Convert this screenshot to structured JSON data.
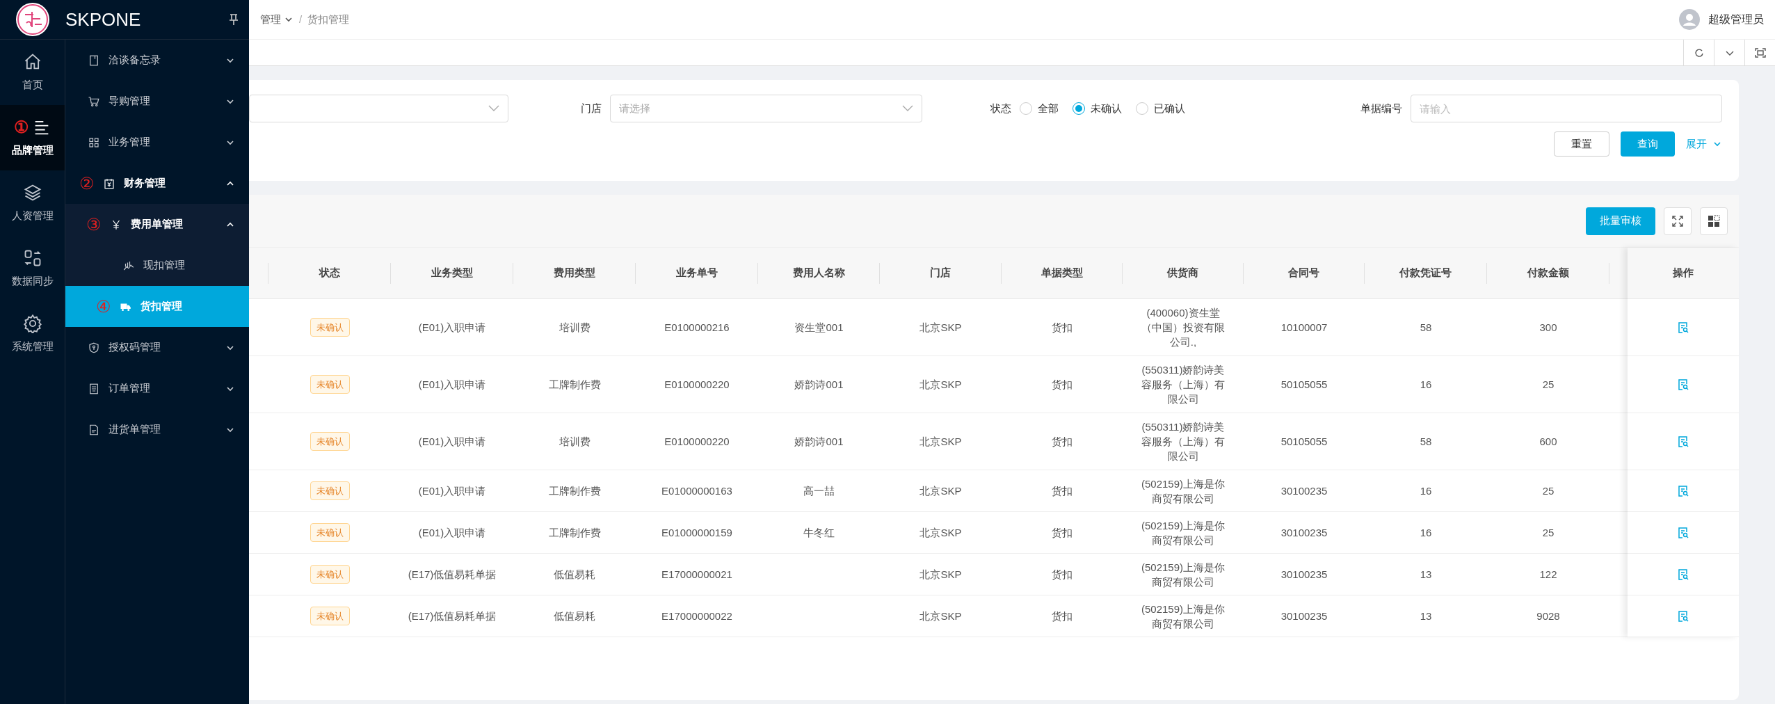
{
  "brand": {
    "name": "SKPONE"
  },
  "icon_nav": [
    {
      "label": "首页",
      "selected": false
    },
    {
      "label": "品牌管理",
      "selected": true,
      "marker": "①"
    },
    {
      "label": "人资管理",
      "selected": false
    },
    {
      "label": "数据同步",
      "selected": false
    },
    {
      "label": "系统管理",
      "selected": false
    }
  ],
  "menu": [
    {
      "label": "洽谈备忘录",
      "expanded": false,
      "selected": false
    },
    {
      "label": "导购管理",
      "expanded": false,
      "selected": false
    },
    {
      "label": "业务管理",
      "expanded": false,
      "selected": false
    },
    {
      "label": "财务管理",
      "expanded": true,
      "selected": false,
      "marker": "②",
      "children": [
        {
          "label": "费用单管理",
          "expanded": true,
          "selected": false,
          "marker": "③",
          "children": [
            {
              "label": "现扣管理",
              "selected": false
            },
            {
              "label": "货扣管理",
              "selected": true,
              "marker": "④"
            }
          ]
        }
      ]
    },
    {
      "label": "授权码管理",
      "expanded": false,
      "selected": false
    },
    {
      "label": "订单管理",
      "expanded": false,
      "selected": false
    },
    {
      "label": "进货单管理",
      "expanded": false,
      "selected": false
    }
  ],
  "breadcrumb": {
    "items": [
      "管理",
      "货扣管理"
    ],
    "separator": "/"
  },
  "user": {
    "name": "超级管理员"
  },
  "filters": {
    "store_label": "门店",
    "store_placeholder": "请选择",
    "status_label": "状态",
    "status_options": [
      {
        "label": "全部",
        "selected": false
      },
      {
        "label": "未确认",
        "selected": true
      },
      {
        "label": "已确认",
        "selected": false
      }
    ],
    "doc_no_label": "单据编号",
    "doc_no_placeholder": "请输入",
    "reset": "重置",
    "query": "查询",
    "expand": "展开"
  },
  "toolbar": {
    "batch": "批量审核"
  },
  "table": {
    "columns": [
      "状态",
      "业务类型",
      "费用类型",
      "业务单号",
      "费用人名称",
      "门店",
      "单据类型",
      "供货商",
      "合同号",
      "付款凭证号",
      "付款金额"
    ],
    "action_column": "操作",
    "rows": [
      {
        "cells": [
          "未确认",
          "(E01)入职申请",
          "培训费",
          "E0100000216",
          "资生堂001",
          "北京SKP",
          "货扣",
          "(400060)资生堂（中国）投资有限公司.,",
          "10100007",
          "58",
          "300"
        ]
      },
      {
        "cells": [
          "未确认",
          "(E01)入职申请",
          "工牌制作费",
          "E0100000220",
          "娇韵诗001",
          "北京SKP",
          "货扣",
          "(550311)娇韵诗美容服务（上海）有限公司",
          "50105055",
          "16",
          "25"
        ]
      },
      {
        "cells": [
          "未确认",
          "(E01)入职申请",
          "培训费",
          "E0100000220",
          "娇韵诗001",
          "北京SKP",
          "货扣",
          "(550311)娇韵诗美容服务（上海）有限公司",
          "50105055",
          "58",
          "600"
        ]
      },
      {
        "cells": [
          "未确认",
          "(E01)入职申请",
          "工牌制作费",
          "E01000000163",
          "高一喆",
          "北京SKP",
          "货扣",
          "(502159)上海是你商贸有限公司",
          "30100235",
          "16",
          "25"
        ]
      },
      {
        "cells": [
          "未确认",
          "(E01)入职申请",
          "工牌制作费",
          "E01000000159",
          "牛冬红",
          "北京SKP",
          "货扣",
          "(502159)上海是你商贸有限公司",
          "30100235",
          "16",
          "25"
        ]
      },
      {
        "cells": [
          "未确认",
          "(E17)低值易耗单据",
          "低值易耗",
          "E17000000021",
          "",
          "北京SKP",
          "货扣",
          "(502159)上海是你商贸有限公司",
          "30100235",
          "13",
          "122"
        ]
      },
      {
        "cells": [
          "未确认",
          "(E17)低值易耗单据",
          "低值易耗",
          "E17000000022",
          "",
          "北京SKP",
          "货扣",
          "(502159)上海是你商贸有限公司",
          "30100235",
          "13",
          "9028"
        ]
      }
    ]
  }
}
